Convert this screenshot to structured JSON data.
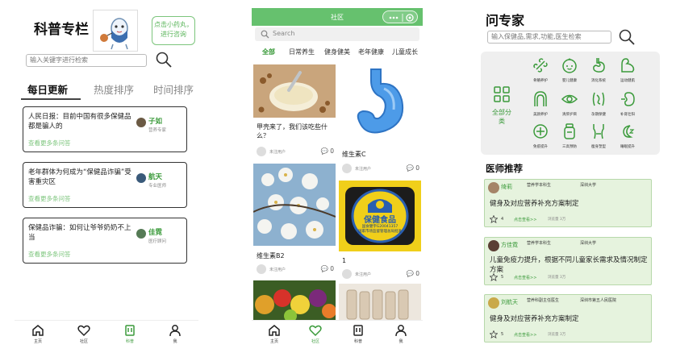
{
  "colors": {
    "accent": "#3a9a3a",
    "header_green": "#66c16e",
    "card_green": "#e6f3de"
  },
  "panel1": {
    "title": "科普专栏",
    "bubble": "点击小药丸，进行咨询",
    "search_placeholder": "输入关键字进行检索",
    "tabs": [
      "每日更新",
      "热度排序",
      "时间排序"
    ],
    "posts": [
      {
        "question": "人民日报：目前中国有很多保健品都是骗人的",
        "link": "查看更多条问答",
        "author": "子如",
        "author_title": "营养专家"
      },
      {
        "question": "老年群体为何成为“保健品诈骗”受害重灾区",
        "link": "查看更多条问答",
        "author": "航天",
        "author_title": "专业医师"
      },
      {
        "question": "保健品诈骗：如何让爷爷奶奶不上当",
        "link": "查看更多条问答",
        "author": "佳霓",
        "author_title": "医疗顾问"
      }
    ],
    "nav": [
      {
        "label": "主页",
        "icon": "home-icon"
      },
      {
        "label": "社区",
        "icon": "heart-icon"
      },
      {
        "label": "科普",
        "icon": "book-icon"
      },
      {
        "label": "我",
        "icon": "user-icon"
      }
    ]
  },
  "panel2": {
    "title": "社区",
    "search_placeholder": "Search",
    "categories": [
      "全部",
      "日常养生",
      "健身健美",
      "老年健康",
      "儿童成长"
    ],
    "posts": [
      {
        "caption": "甲壳来了，我们该吃些什么？",
        "user": "未注用户",
        "count": "0"
      },
      {
        "caption": "维生素C",
        "user": "未注用户",
        "count": "0"
      },
      {
        "caption": "维生素B2",
        "user": "未注用户",
        "count": "0"
      },
      {
        "caption": "1",
        "user": "未注用户",
        "count": "0"
      }
    ],
    "badge": {
      "line1": "保健食品",
      "line2": "国食健字G20041357",
      "line3": "国家市场监督管理总局批准"
    },
    "nav": [
      {
        "label": "主页",
        "icon": "home-icon"
      },
      {
        "label": "社区",
        "icon": "heart-icon"
      },
      {
        "label": "科普",
        "icon": "book-icon"
      },
      {
        "label": "我",
        "icon": "user-icon"
      }
    ]
  },
  "panel3": {
    "title": "问专家",
    "search_placeholder": "输入保健品,需求,功能,医生检索",
    "all_label": "全部分类",
    "categories": [
      {
        "label": "骨骼养护",
        "icon": "bone-icon"
      },
      {
        "label": "婴儿健康",
        "icon": "baby-icon"
      },
      {
        "label": "消化系统",
        "icon": "stomach-icon"
      },
      {
        "label": "运动健肌",
        "icon": "muscle-icon"
      },
      {
        "label": "美颜养护",
        "icon": "face-icon"
      },
      {
        "label": "清肝护目",
        "icon": "eye-icon"
      },
      {
        "label": "孕期保健",
        "icon": "pregnancy-icon"
      },
      {
        "label": "补肾壮阳",
        "icon": "kidney-icon"
      },
      {
        "label": "免疫提升",
        "icon": "immune-icon"
      },
      {
        "label": "三高预防",
        "icon": "bottle-icon"
      },
      {
        "label": "瘦身塑型",
        "icon": "body-icon"
      },
      {
        "label": "睡眠提升",
        "icon": "sleep-icon"
      }
    ],
    "section_title": "医师推荐",
    "doctors": [
      {
        "name": "绮莉",
        "title": "营养学本科生",
        "org": "深圳大学",
        "question": "健身及对应营养补充方案制定",
        "likes": "4",
        "more": "点击查看>>",
        "views": "浏览量 3万"
      },
      {
        "name": "方佳霓",
        "title": "营养学本科生",
        "org": "深圳大学",
        "question": "儿童免疫力提升，根据不同儿童家长需求及情况制定方案",
        "likes": "5",
        "more": "点击查看>>",
        "views": "浏览量 3万"
      },
      {
        "name": "刘航天",
        "title": "营养科副主任医生",
        "org": "深圳市第五人民医院",
        "question": "健身及对应营养补充方案制定",
        "likes": "5",
        "more": "点击查看>>",
        "views": "浏览量 3万"
      }
    ]
  }
}
